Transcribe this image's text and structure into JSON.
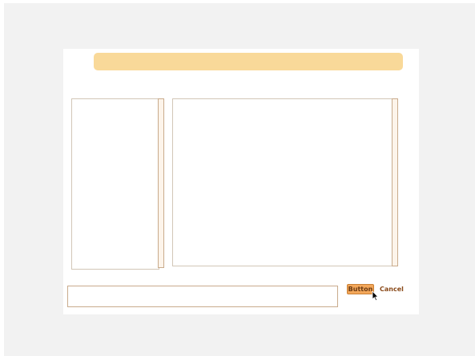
{
  "dialog": {
    "title": "",
    "input": {
      "value": "",
      "placeholder": ""
    },
    "actions": {
      "primary_label": "Button",
      "cancel_label": "Cancel"
    }
  },
  "colors": {
    "title_bar": "#f9d999",
    "primary_button": "#f3a75a",
    "accent_text": "#8a4a1a",
    "border": "#c9ab8c",
    "backdrop": "#f2f2f2"
  },
  "icons": {
    "cursor": "mouse-pointer-icon"
  }
}
